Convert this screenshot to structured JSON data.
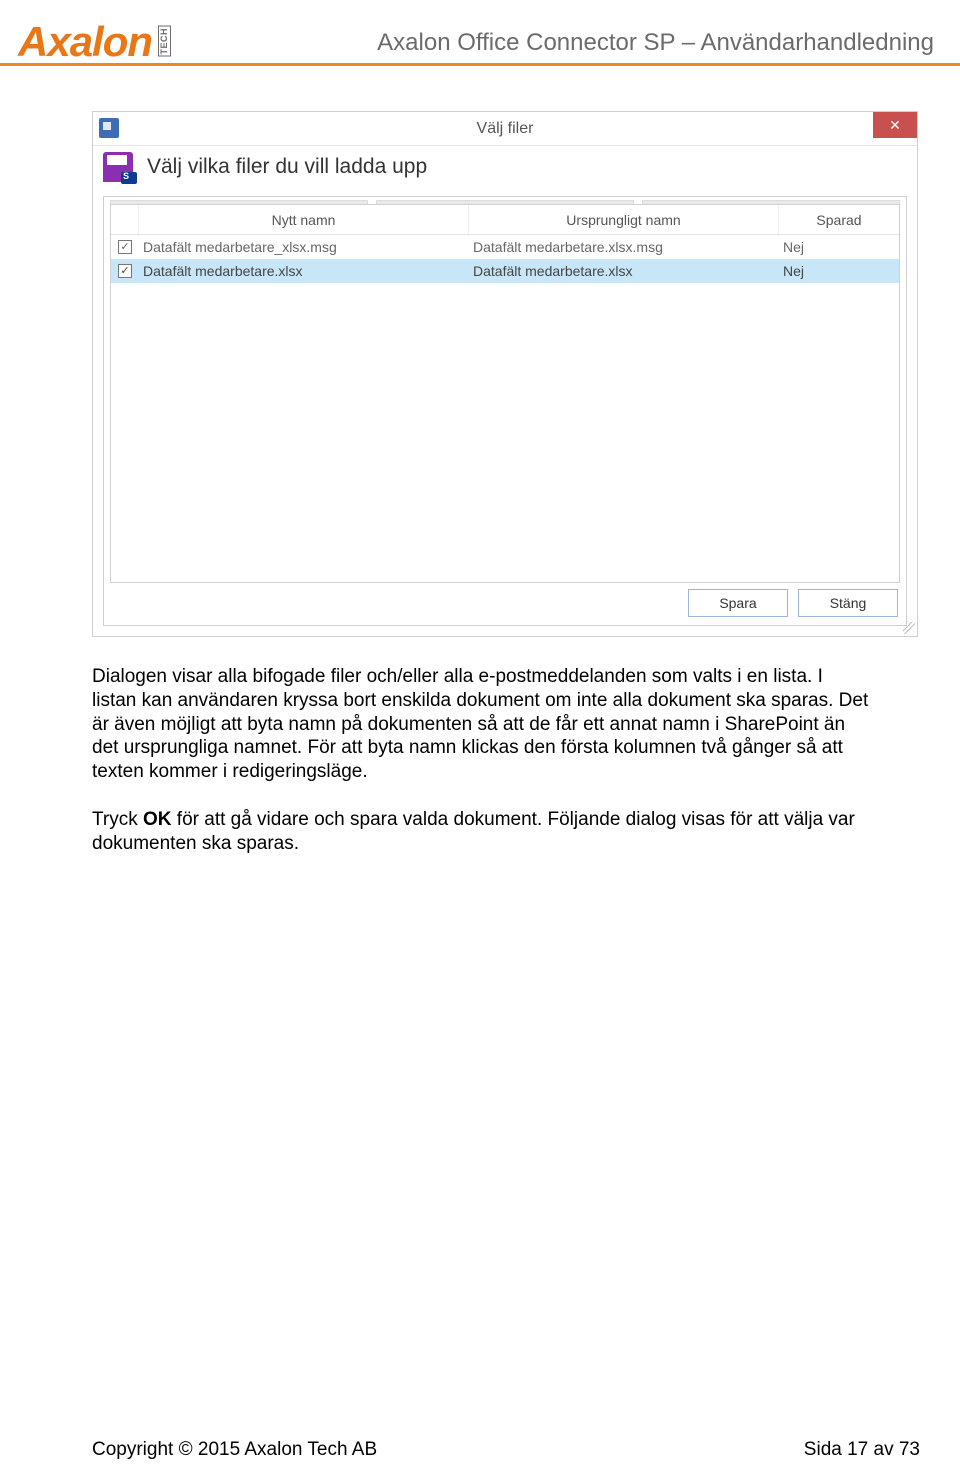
{
  "header": {
    "logo_text": "Axalon",
    "logo_tech": "TECH",
    "doc_title": "Axalon Office Connector SP – Användarhandledning"
  },
  "dialog": {
    "title": "Välj filer",
    "subtitle": "Välj vilka filer du vill ladda upp",
    "columns": {
      "new_name": "Nytt namn",
      "original_name": "Ursprungligt namn",
      "saved": "Sparad"
    },
    "rows": [
      {
        "checked": true,
        "selected": false,
        "new_name": "Datafält medarbetare_xlsx.msg",
        "original_name": "Datafält medarbetare.xlsx.msg",
        "saved": "Nej"
      },
      {
        "checked": true,
        "selected": true,
        "new_name": "Datafält medarbetare.xlsx",
        "original_name": "Datafält medarbetare.xlsx",
        "saved": "Nej"
      }
    ],
    "buttons": {
      "save": "Spara",
      "close": "Stäng"
    }
  },
  "body": {
    "p1": "Dialogen visar alla bifogade filer och/eller alla e-postmeddelanden som valts i en lista. I listan kan användaren kryssa bort enskilda dokument om inte alla dokument ska sparas. Det är även möjligt att byta namn på dokumenten så att de får ett annat namn i SharePoint än det ursprungliga namnet. För att byta namn klickas den första kolumnen två gånger så att texten kommer i redigeringsläge.",
    "p2_pre": "Tryck ",
    "p2_bold": "OK",
    "p2_post": " för att gå vidare och spara valda dokument. Följande dialog visas för att välja var dokumenten ska sparas."
  },
  "footer": {
    "copyright": "Copyright © 2015 Axalon Tech AB",
    "page_info": "Sida 17 av 73"
  }
}
